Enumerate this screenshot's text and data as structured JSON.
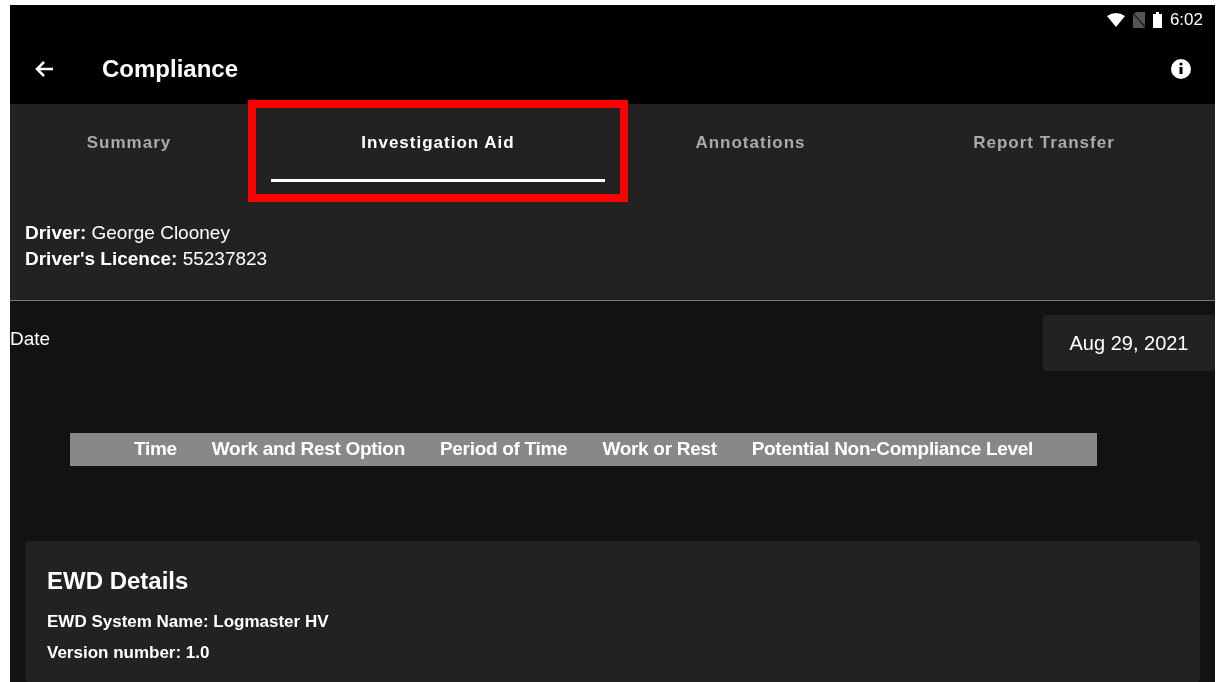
{
  "status_bar": {
    "time": "6:02"
  },
  "app_bar": {
    "title": "Compliance"
  },
  "tabs": [
    {
      "label": "Summary",
      "selected": false,
      "highlighted": false
    },
    {
      "label": "Investigation Aid",
      "selected": true,
      "highlighted": true
    },
    {
      "label": "Annotations",
      "selected": false,
      "highlighted": false
    },
    {
      "label": "Report Transfer",
      "selected": false,
      "highlighted": false
    }
  ],
  "driver_info": [
    "**Driver:** George Clooney",
    "**Driver's Licence:** 55237823"
  ],
  "date": {
    "label": "Date",
    "value": "Aug 29, 2021"
  },
  "table": {
    "columns": [
      "Time",
      "Work and Rest Option",
      "Period of Time",
      "Work or Rest",
      "Potential Non-Compliance Level"
    ]
  },
  "ewd_details": {
    "title": "EWD Details",
    "lines": [
      "EWD System Name: Logmaster HV",
      "Version number: 1.0"
    ]
  }
}
